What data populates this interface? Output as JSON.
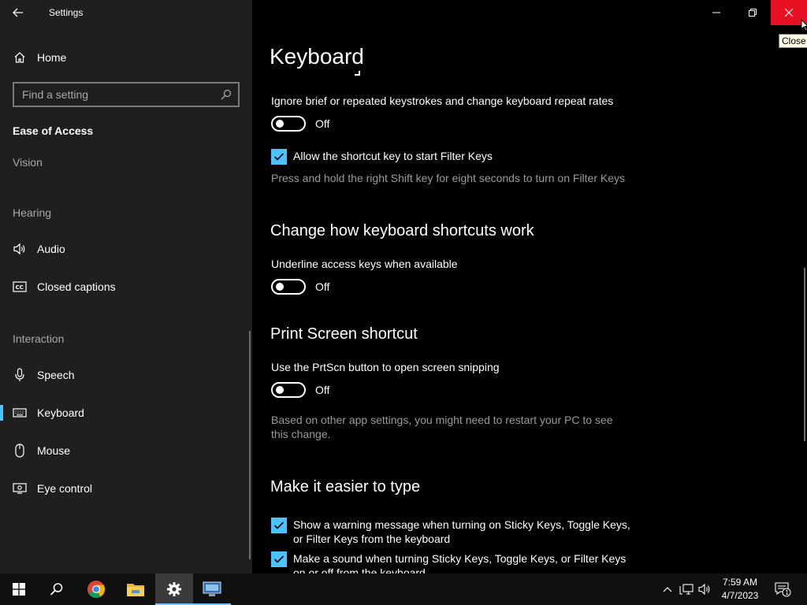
{
  "window": {
    "title": "Settings",
    "close_tooltip": "Close"
  },
  "sidebar": {
    "home_label": "Home",
    "search_placeholder": "Find a setting",
    "category": "Ease of Access",
    "groups": {
      "vision": "Vision",
      "hearing": "Hearing",
      "interaction": "Interaction"
    },
    "items": {
      "audio": "Audio",
      "closed_captions": "Closed captions",
      "speech": "Speech",
      "keyboard": "Keyboard",
      "mouse": "Mouse",
      "eye_control": "Eye control"
    },
    "selected": "Keyboard",
    "accent_color": "#4cc2ff"
  },
  "main": {
    "page_title": "Keyboard",
    "filter_keys": {
      "label": "Ignore brief or repeated keystrokes and change keyboard repeat rates",
      "toggle_state": "Off",
      "shortcut_checkbox_label": "Allow the shortcut key to start Filter Keys",
      "shortcut_checked": true,
      "shortcut_desc": "Press and hold the right Shift key for eight seconds to turn on Filter Keys"
    },
    "shortcuts_section": {
      "title": "Change how keyboard shortcuts work",
      "underline_label": "Underline access keys when available",
      "underline_state": "Off"
    },
    "print_screen_section": {
      "title": "Print Screen shortcut",
      "label": "Use the PrtScn button to open screen snipping",
      "state": "Off",
      "desc": "Based on other app settings, you might need to restart your PC to see this change."
    },
    "typing_section": {
      "title": "Make it easier to type",
      "warning_label": "Show a warning message when turning on Sticky Keys, Toggle Keys, or Filter Keys from the keyboard",
      "warning_checked": true,
      "sound_label": "Make a sound when turning Sticky Keys, Toggle Keys, or Filter Keys on or off from the keyboard",
      "sound_checked": true
    }
  },
  "taskbar": {
    "time": "7:59 AM",
    "date": "4/7/2023",
    "notification_count": "1",
    "apps": [
      "start-icon",
      "search-icon",
      "chrome-icon",
      "file-explorer-icon",
      "settings-icon",
      "network-app-icon"
    ]
  }
}
